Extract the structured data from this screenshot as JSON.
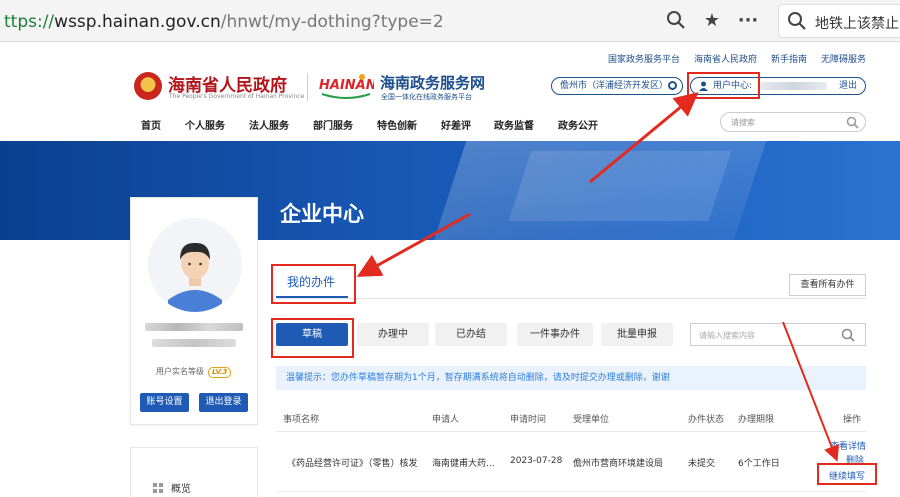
{
  "browser": {
    "url_scheme": "ttps://",
    "url_host": "wssp.hainan.gov.cn",
    "url_path": "/hnwt/my-dothing?type=2",
    "search_text": "地铁上该禁止"
  },
  "header": {
    "top_links": [
      "国家政务服务平台",
      "海南省人民政府",
      "新手指南",
      "无障碍服务"
    ],
    "gov_title": "海南省人民政府",
    "gov_subtitle": "The People's Government of Hainan Province",
    "hainan_logo_text": "HAINAN",
    "service_title": "海南政务服务网",
    "service_subtitle": "全国一体化在线政务服务平台",
    "region": "儋州市（洋浦经济开发区）",
    "user_center_label": "用户中心:",
    "logout_label": "退出"
  },
  "nav": {
    "items": [
      "首页",
      "个人服务",
      "法人服务",
      "部门服务",
      "特色创新",
      "好差评",
      "政务监督",
      "政务公开"
    ],
    "search_placeholder": "请搜索"
  },
  "banner": {
    "title": "企业中心"
  },
  "profile": {
    "real_name_level_label": "用户实名等级",
    "level_badge": "LV.3",
    "account_settings": "账号设置",
    "logout": "退出登录"
  },
  "side_menu": {
    "overview": "概览"
  },
  "main": {
    "tab_label": "我的办件",
    "view_all": "查看所有办件",
    "filter_tabs": [
      "草稿",
      "办理中",
      "已办结",
      "一件事办件",
      "批量申报"
    ],
    "search_placeholder": "请输入搜索内容",
    "tip": "温馨提示：您办件草稿暂存期为1个月，暂存期满系统将自动删除，请及时提交办理或删除，谢谢",
    "columns": [
      "事项名称",
      "申请人",
      "申请时间",
      "受理单位",
      "办件状态",
      "办理期限",
      "操作"
    ],
    "rows": [
      {
        "name": "《药品经营许可证》（零售）核发",
        "applicant": "海南健甫大药...",
        "date": "2023-07-28",
        "unit": "儋州市营商环境建设局",
        "status": "未提交",
        "deadline": "6个工作日",
        "actions": [
          "查看详情",
          "删除",
          "继续填写"
        ]
      }
    ]
  },
  "colors": {
    "primary": "#1f5bb5",
    "gov_red": "#b3151b",
    "annotation_red": "#e32a1f",
    "tip_bg": "#eaf3fd"
  }
}
